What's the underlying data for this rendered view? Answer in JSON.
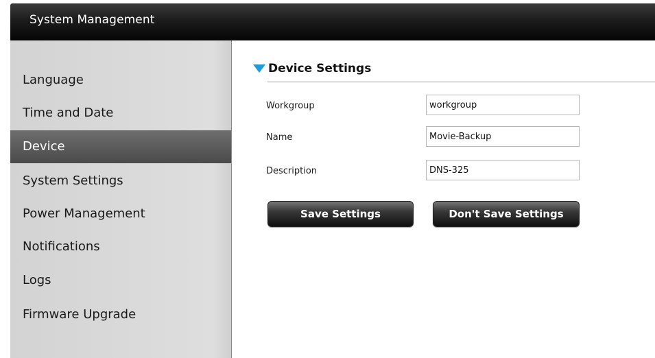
{
  "header": {
    "title": "System Management"
  },
  "sidebar": {
    "items": [
      {
        "label": "Language"
      },
      {
        "label": "Time and Date"
      },
      {
        "label": "Device",
        "active": true
      },
      {
        "label": "System Settings"
      },
      {
        "label": "Power Management"
      },
      {
        "label": "Notifications"
      },
      {
        "label": "Logs"
      },
      {
        "label": "Firmware Upgrade"
      }
    ]
  },
  "device_settings": {
    "title": "Device Settings",
    "fields": [
      {
        "label": "Workgroup",
        "value": "workgroup"
      },
      {
        "label": "Name",
        "value": "Movie-Backup"
      },
      {
        "label": "Description",
        "value": "DNS-325"
      }
    ],
    "save_label": "Save Settings",
    "dont_save_label": "Don't Save Settings"
  },
  "colors": {
    "accent": "#1e9bd8",
    "header_bg": "#1c1c1c",
    "sidebar_bg": "#d8d8d8",
    "active_item_bg": "#5a5a5a"
  },
  "icons": {
    "section_toggle": "triangle-down-icon"
  }
}
